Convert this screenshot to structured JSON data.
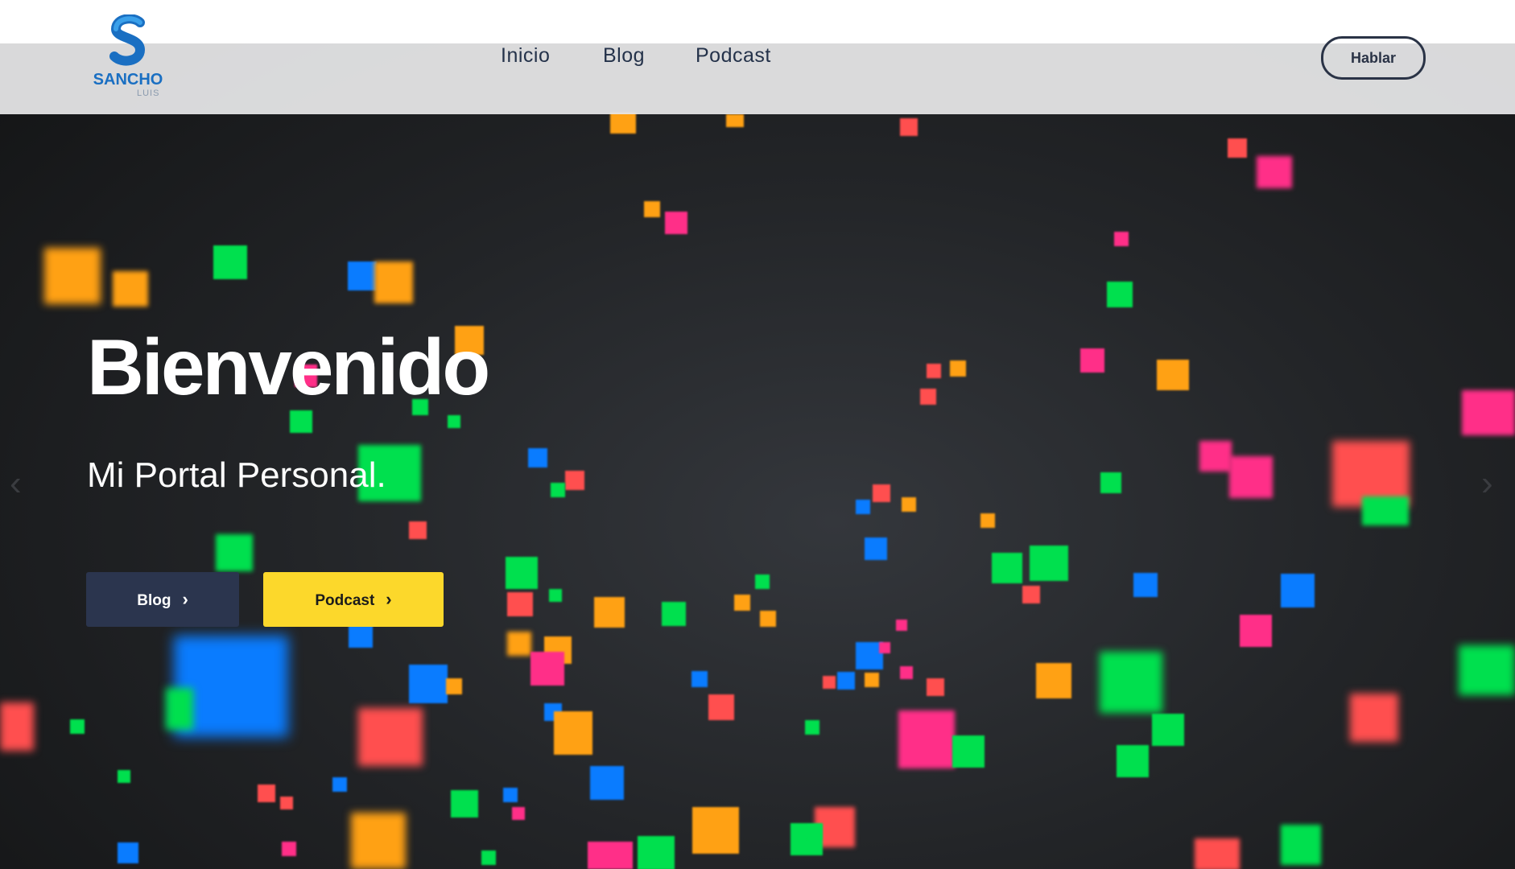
{
  "header": {
    "logo_name": "SANCHO",
    "logo_sub": "LUIS",
    "nav": [
      "Inicio",
      "Blog",
      "Podcast"
    ],
    "cta_label": "Hablar"
  },
  "hero": {
    "title": "Bienvenido",
    "subtitle": "Mi Portal Personal.",
    "buttons": [
      {
        "label": "Blog",
        "icon": "chevron-right-icon"
      },
      {
        "label": "Podcast",
        "icon": "chevron-right-icon"
      }
    ],
    "prev_icon": "chevron-left-icon",
    "next_icon": "chevron-right-icon"
  },
  "colors": {
    "brand_blue": "#1a6fc2",
    "nav_text": "#24324a",
    "blog_button": "#2b354e",
    "podcast_button": "#fcd82b",
    "confetti": [
      "#00e04e",
      "#0a7cff",
      "#ff2f88",
      "#ffa114",
      "#ff4f4f"
    ]
  }
}
